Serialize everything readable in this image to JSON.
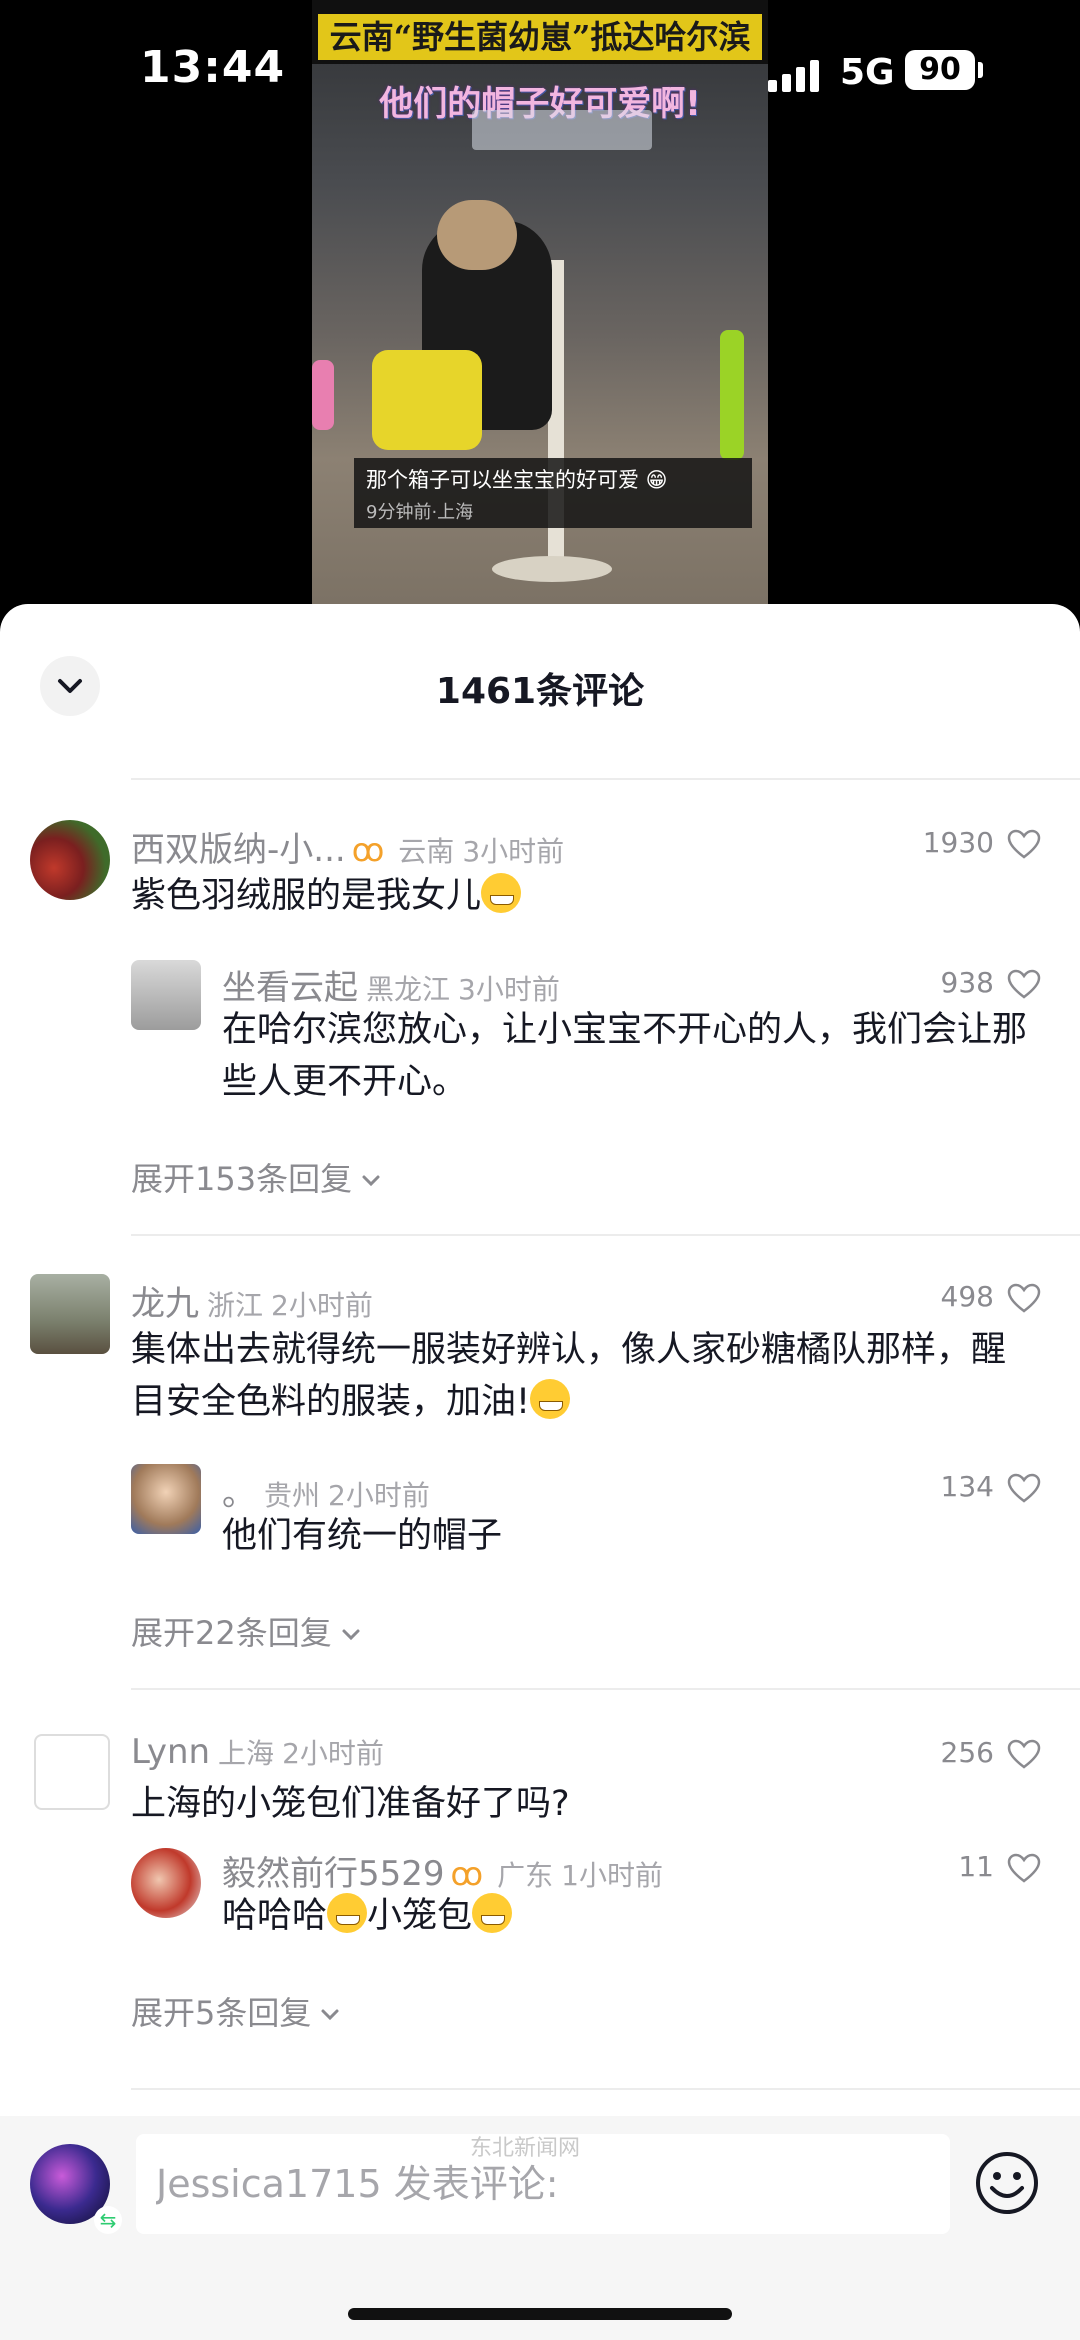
{
  "status_bar": {
    "time": "13:44",
    "network": "5G",
    "battery": "90"
  },
  "video": {
    "title": "云南“野生菌幼崽”抵达哈尔滨",
    "subtitle": "他们的帽子好可爱啊!",
    "caption_text": "那个箱子可以坐宝宝的好可爱 😁",
    "caption_meta": "9分钟前·上海"
  },
  "comments_panel": {
    "title": "1461条评论",
    "threads": [
      {
        "user": "西双版纳-小...",
        "location": "云南",
        "time": "3小时前",
        "likes": "1930",
        "text": "紫色羽绒服的是我女儿",
        "reply": {
          "user": "坐看云起",
          "location": "黑龙江",
          "time": "3小时前",
          "likes": "938",
          "text": "在哈尔滨您放心，让小宝宝不开心的人，我们会让那些人更不开心。"
        },
        "expand": "展开153条回复"
      },
      {
        "user": "龙九",
        "location": "浙江",
        "time": "2小时前",
        "likes": "498",
        "text": "集体出去就得统一服装好辨认，像人家砂糖橘队那样，醒目安全色料的服装，加油!",
        "reply": {
          "user": "。",
          "location": "贵州",
          "time": "2小时前",
          "likes": "134",
          "text": "他们有统一的帽子"
        },
        "expand": "展开22条回复"
      },
      {
        "user": "Lynn",
        "location": "上海",
        "time": "2小时前",
        "likes": "256",
        "text": "上海的小笼包们准备好了吗?",
        "reply": {
          "user": "毅然前行5529",
          "location": "广东",
          "time": "1小时前",
          "likes": "11",
          "text_a": "哈哈哈",
          "text_b": "小笼包"
        },
        "expand": "展开5条回复"
      }
    ]
  },
  "composer": {
    "placeholder": "Jessica1715 发表评论:",
    "watermark": "东北新闻网"
  },
  "colors": {
    "accent_tag": "#f4a12a",
    "text": "#161823",
    "muted": "#8a8a8f"
  }
}
